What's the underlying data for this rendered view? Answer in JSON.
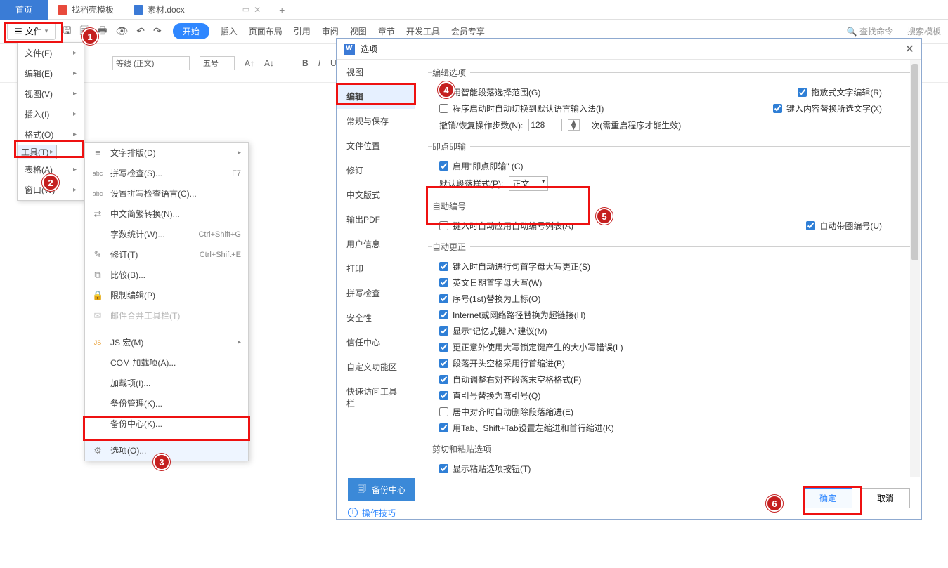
{
  "tabs": {
    "home": "首页",
    "template": "找稻壳模板",
    "doc": "素材.docx",
    "plus": "+"
  },
  "file_btn": "文件",
  "ribbon": [
    "开始",
    "插入",
    "页面布局",
    "引用",
    "审阅",
    "视图",
    "章节",
    "开发工具",
    "会员专享"
  ],
  "search": {
    "cmd": "查找命令",
    "tpl": "搜索模板"
  },
  "rib2": {
    "font": "等线 (正文)",
    "size": "五号"
  },
  "filemenu": [
    "文件(F)",
    "编辑(E)",
    "视图(V)",
    "插入(I)",
    "格式(O)",
    "工具(T)",
    "表格(A)",
    "窗口(W)"
  ],
  "submenu": {
    "items": [
      {
        "ic": "≡",
        "t": "文字排版(D)",
        "arr": true
      },
      {
        "ic": "abc",
        "t": "拼写检查(S)...",
        "sc": "F7"
      },
      {
        "ic": "abc",
        "t": "设置拼写检查语言(C)..."
      },
      {
        "ic": "⇄",
        "t": "中文简繁转换(N)..."
      },
      {
        "ic": "",
        "t": "字数统计(W)...",
        "sc": "Ctrl+Shift+G"
      },
      {
        "ic": "✎",
        "t": "修订(T)",
        "sc": "Ctrl+Shift+E"
      },
      {
        "ic": "⧉",
        "t": "比较(B)..."
      },
      {
        "ic": "🔒",
        "t": "限制编辑(P)"
      },
      {
        "ic": "✉",
        "t": "邮件合并工具栏(T)",
        "dis": true
      }
    ],
    "items2": [
      {
        "ic": "JS",
        "t": "JS 宏(M)",
        "arr": true
      },
      {
        "t": "COM 加载项(A)..."
      },
      {
        "t": "加载项(I)..."
      },
      {
        "t": "备份管理(K)..."
      },
      {
        "t": "备份中心(K)..."
      }
    ],
    "options": "选项(O)..."
  },
  "dialog": {
    "title": "选项",
    "nav": [
      "视图",
      "编辑",
      "常规与保存",
      "文件位置",
      "修订",
      "中文版式",
      "输出PDF",
      "用户信息",
      "打印",
      "拼写检查",
      "安全性",
      "信任中心",
      "自定义功能区",
      "快速访问工具栏"
    ],
    "nav_active": 1,
    "sec_edit": "编辑选项",
    "edit_smart": "用智能段落选择范围(G)",
    "edit_drag": "拖放式文字编辑(R)",
    "edit_ime": "程序启动时自动切换到默认语言输入法(I)",
    "edit_replace": "键入内容替换所选文字(X)",
    "undo_label": "撤销/恢复操作步数(N):",
    "undo_val": "128",
    "undo_note": "次(需重启程序才能生效)",
    "sec_click": "即点即输",
    "click_enable": "启用\"即点即输\" (C)",
    "para_style_l": "默认段落样式(P):",
    "para_style_v": "正文",
    "sec_autonum": "自动编号",
    "autonum_apply": "键入时自动应用自动编号列表(A)",
    "autonum_circle": "自动带圈编号(U)",
    "sec_autofix": "自动更正",
    "af": [
      "键入时自动进行句首字母大写更正(S)",
      "英文日期首字母大写(W)",
      "序号(1st)替换为上标(O)",
      "Internet或网络路径替换为超链接(H)",
      "显示\"记忆式键入\"建议(M)",
      "更正意外使用大写锁定键产生的大小写错误(L)",
      "段落开头空格采用行首缩进(B)",
      "自动调整右对齐段落末空格格式(F)",
      "直引号替换为弯引号(Q)",
      "居中对齐时自动删除段落缩进(E)",
      "用Tab、Shift+Tab设置左缩进和首行缩进(K)"
    ],
    "af_unchecked": [
      9
    ],
    "sec_paste": "剪切和粘贴选项",
    "paste_btn": "显示粘贴选项按钮(T)",
    "backup": "备份中心",
    "tips": "操作技巧",
    "ok": "确定",
    "cancel": "取消"
  },
  "badges": [
    "1",
    "2",
    "3",
    "4",
    "5",
    "6"
  ]
}
